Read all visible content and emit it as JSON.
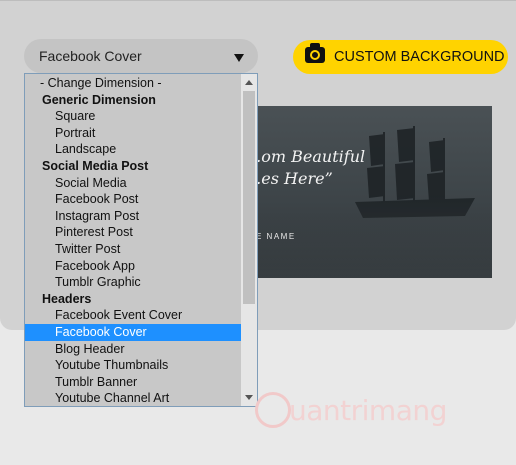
{
  "select": {
    "value": "Facebook Cover"
  },
  "custom_background": {
    "label": "CUSTOM BACKGROUND"
  },
  "preview": {
    "line1": "...om Beautiful",
    "line2": "...es Here”",
    "name": "E NAME"
  },
  "dropdown": {
    "items": [
      {
        "label": "- Change Dimension -",
        "kind": "first"
      },
      {
        "label": "Generic Dimension",
        "kind": "group"
      },
      {
        "label": "Square",
        "kind": "item"
      },
      {
        "label": "Portrait",
        "kind": "item"
      },
      {
        "label": "Landscape",
        "kind": "item"
      },
      {
        "label": "Social Media Post",
        "kind": "group"
      },
      {
        "label": "Social Media",
        "kind": "item"
      },
      {
        "label": "Facebook Post",
        "kind": "item"
      },
      {
        "label": "Instagram Post",
        "kind": "item"
      },
      {
        "label": "Pinterest Post",
        "kind": "item"
      },
      {
        "label": "Twitter Post",
        "kind": "item"
      },
      {
        "label": "Facebook App",
        "kind": "item"
      },
      {
        "label": "Tumblr Graphic",
        "kind": "item"
      },
      {
        "label": "Headers",
        "kind": "group"
      },
      {
        "label": "Facebook Event Cover",
        "kind": "item"
      },
      {
        "label": "Facebook Cover",
        "kind": "item",
        "selected": true
      },
      {
        "label": "Blog Header",
        "kind": "item"
      },
      {
        "label": "Youtube Thumbnails",
        "kind": "item"
      },
      {
        "label": "Tumblr Banner",
        "kind": "item"
      },
      {
        "label": "Youtube Channel Art",
        "kind": "item"
      }
    ]
  },
  "watermark": {
    "text": "uantrimang"
  },
  "colors": {
    "accent": "#ffd300",
    "selected": "#1e90ff"
  },
  "icons": {
    "camera": "camera-icon",
    "dropdown": "chevron-down-icon"
  }
}
